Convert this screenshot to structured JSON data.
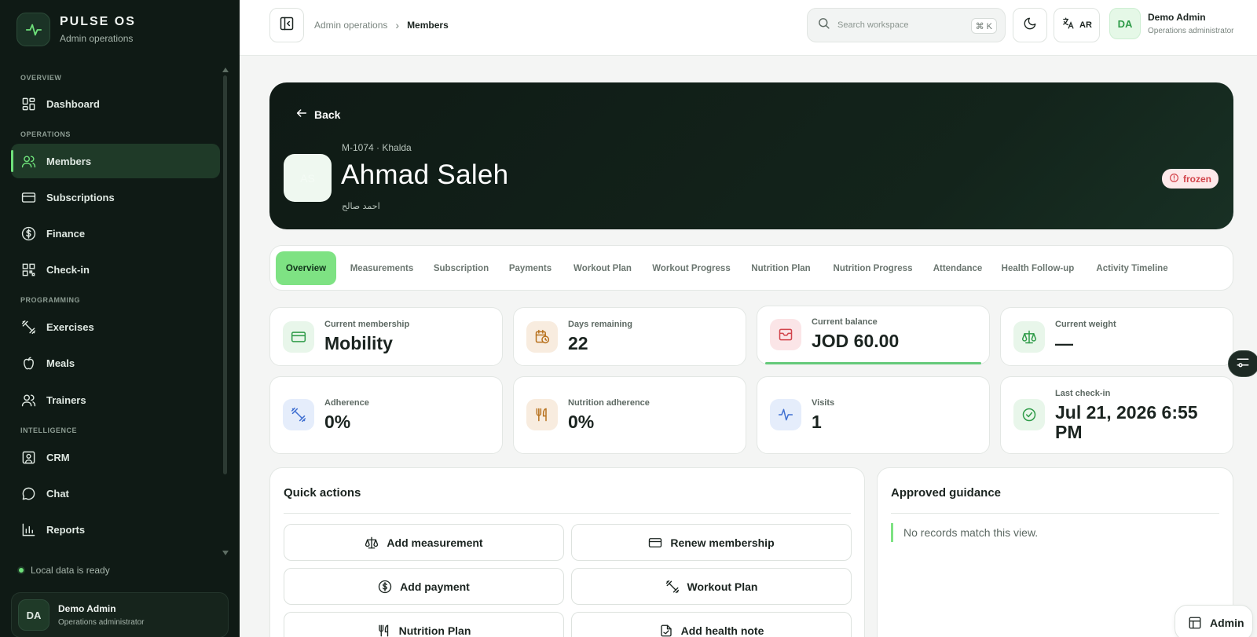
{
  "brand": {
    "title": "PULSE OS",
    "subtitle": "Admin operations"
  },
  "sidebar": {
    "sections": [
      "Overview",
      "Operations",
      "Programming",
      "Intelligence"
    ],
    "items": [
      {
        "label": "Dashboard",
        "icon": "dashboard-icon"
      },
      {
        "label": "Members",
        "icon": "users-icon",
        "active": true
      },
      {
        "label": "Subscriptions",
        "icon": "card-icon"
      },
      {
        "label": "Finance",
        "icon": "dollar-icon"
      },
      {
        "label": "Check-in",
        "icon": "qr-icon"
      },
      {
        "label": "Exercises",
        "icon": "dumbbell-icon"
      },
      {
        "label": "Meals",
        "icon": "apple-icon"
      },
      {
        "label": "Trainers",
        "icon": "users-icon"
      },
      {
        "label": "CRM",
        "icon": "contact-icon"
      },
      {
        "label": "Chat",
        "icon": "chat-icon"
      },
      {
        "label": "Reports",
        "icon": "bar-chart-icon"
      }
    ],
    "status": "Local data is ready",
    "user": {
      "initials": "DA",
      "name": "Demo Admin",
      "role": "Operations administrator"
    }
  },
  "topbar": {
    "breadcrumb": [
      "Admin operations",
      "Members"
    ],
    "search_placeholder": "Search workspace",
    "shortcut": "⌘ K",
    "language": "AR",
    "user": {
      "initials": "DA",
      "name": "Demo Admin",
      "role": "Operations administrator"
    }
  },
  "member": {
    "back_label": "Back",
    "initials": "AS",
    "id_line": "M-1074 · Khalda",
    "name": "Ahmad Saleh",
    "name_ar": "احمد صالح",
    "status": "frozen"
  },
  "tabs": [
    "Overview",
    "Measurements",
    "Subscription",
    "Payments",
    "Workout Plan",
    "Workout Progress",
    "Nutrition Plan",
    "Nutrition Progress",
    "Attendance",
    "Health Follow-up",
    "Activity Timeline"
  ],
  "stats": [
    {
      "label": "Current membership",
      "value": "Mobility",
      "icon": "card-icon",
      "color": "#2e9b48"
    },
    {
      "label": "Days remaining",
      "value": "22",
      "icon": "calendar-clock-icon",
      "color": "#b8721f"
    },
    {
      "label": "Current balance",
      "value": "JOD 60.00",
      "icon": "wallet-icon",
      "color": "#d2444b"
    },
    {
      "label": "Current weight",
      "value": "—",
      "icon": "scale-icon",
      "color": "#2e9b48"
    },
    {
      "label": "Adherence",
      "value": "0%",
      "icon": "dumbbell-icon",
      "color": "#3f6fd1"
    },
    {
      "label": "Nutrition adherence",
      "value": "0%",
      "icon": "utensils-icon",
      "color": "#b8721f"
    },
    {
      "label": "Visits",
      "value": "1",
      "icon": "activity-icon",
      "color": "#3f6fd1"
    },
    {
      "label": "Last check-in",
      "value": "Jul 21, 2026 6:55 PM",
      "icon": "check-circle-icon",
      "color": "#2e9b48"
    }
  ],
  "quick_actions": {
    "title": "Quick actions",
    "buttons": [
      {
        "label": "Add measurement",
        "icon": "scale-icon"
      },
      {
        "label": "Renew membership",
        "icon": "card-icon"
      },
      {
        "label": "Add payment",
        "icon": "dollar-icon"
      },
      {
        "label": "Workout Plan",
        "icon": "dumbbell-icon"
      },
      {
        "label": "Nutrition Plan",
        "icon": "utensils-icon"
      },
      {
        "label": "Add health note",
        "icon": "note-icon"
      }
    ]
  },
  "guidance": {
    "title": "Approved guidance",
    "empty": "No records match this view."
  },
  "admin_pill": "Admin"
}
